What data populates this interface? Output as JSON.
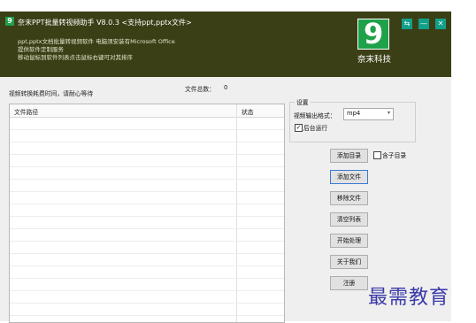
{
  "titlebar": {
    "icon_glyph": "9",
    "title": "奈末PPT批量转视频助手   V8.0.3  <支持ppt,pptx文件>",
    "buttons": {
      "pin": "⇆",
      "minimize": "—",
      "close": "✕"
    }
  },
  "header": {
    "description": [
      "ppt,pptx文档批量转视频软件  电脑须安装有Microsoft Office",
      "提供软件定制服务",
      "移动鼠标到软件列表点击鼠标右键可对其排序"
    ],
    "logo": {
      "glyph": "9",
      "dots": "...",
      "name": "奈末科技",
      "color": "#1fa14a"
    }
  },
  "status": {
    "message": "视频转换耗费时间，请耐心等待",
    "file_count_label": "文件总数：",
    "file_count": "0"
  },
  "table": {
    "columns": [
      "文件路径",
      "状态"
    ],
    "rows": []
  },
  "settings": {
    "title": "设置",
    "format_label": "视频输出格式：",
    "format_value": "mp4",
    "background_label": "后台运行",
    "background_checked": true
  },
  "actions": {
    "add_dir": "添加目录",
    "subdir_label": "含子目录",
    "subdir_checked": false,
    "add_file": "添加文件",
    "remove_file": "移除文件",
    "clear_list": "清空列表",
    "start": "开始处理",
    "about": "关于我们",
    "register": "注册"
  },
  "watermark": "最需教育"
}
